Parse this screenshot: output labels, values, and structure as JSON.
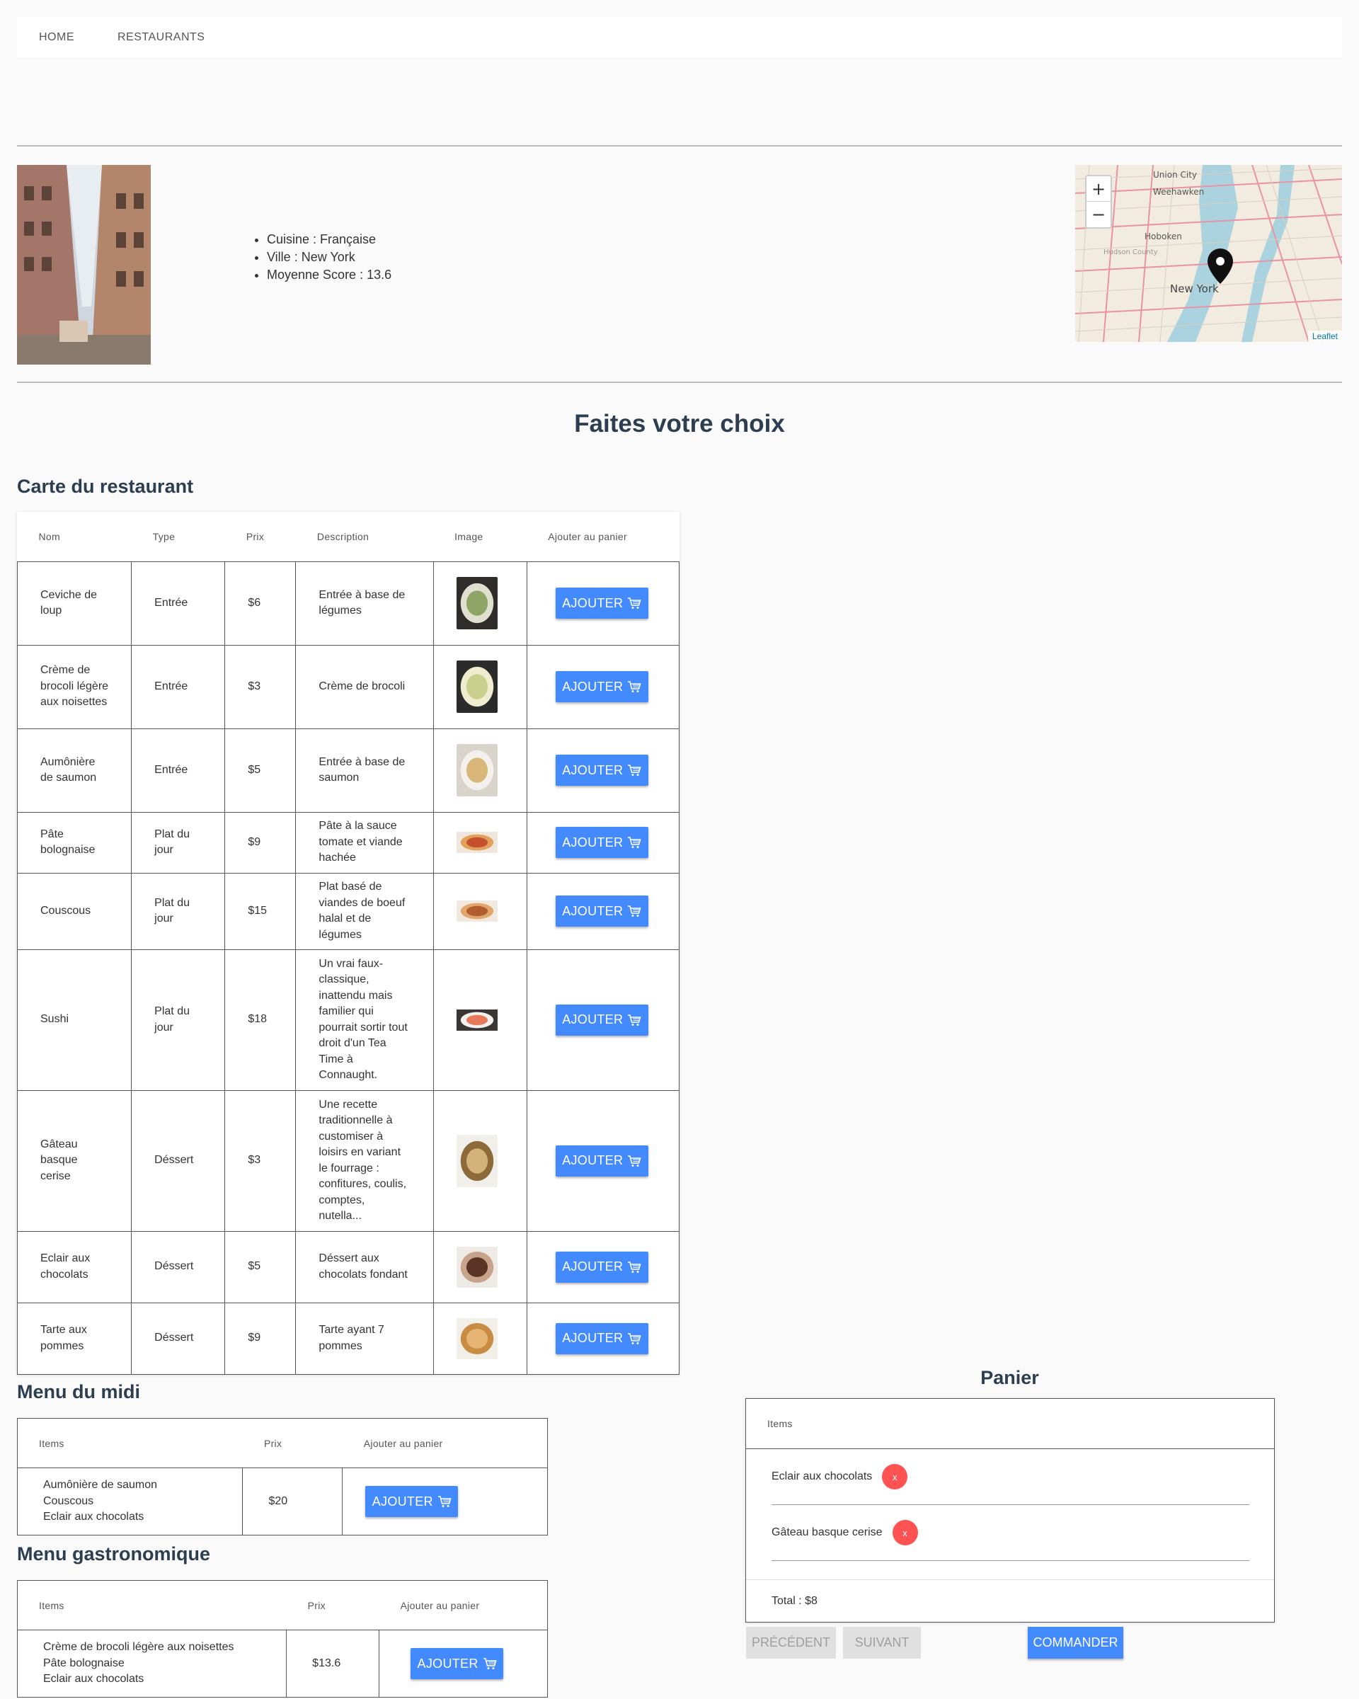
{
  "nav": {
    "items": [
      "HOME",
      "RESTAURANTS"
    ]
  },
  "restaurant": {
    "cuisine": "Cuisine : Française",
    "ville": "Ville : New York",
    "score": "Moyenne Score : 13.6"
  },
  "map": {
    "zoom_in": "+",
    "zoom_out": "−",
    "attribution": "Leaflet",
    "labels": [
      "Union City",
      "Weehawken",
      "Hoboken",
      "Hudson County",
      "New York"
    ]
  },
  "main_title": "Faites votre choix",
  "carte": {
    "title": "Carte du restaurant",
    "headers": [
      "Nom",
      "Type",
      "Prix",
      "Description",
      "Image",
      "Ajouter au panier"
    ],
    "button_label": "AJOUTER",
    "rows": [
      {
        "nom": "Ceviche de loup",
        "type": "Entrée",
        "prix": "$6",
        "description": "Entrée à base de légumes"
      },
      {
        "nom": "Crème de brocoli légère aux noisettes",
        "type": "Entrée",
        "prix": "$3",
        "description": "Crème de brocoli"
      },
      {
        "nom": "Aumônière de saumon",
        "type": "Entrée",
        "prix": "$5",
        "description": "Entrée à base de saumon"
      },
      {
        "nom": "Pâte bolognaise",
        "type": "Plat du jour",
        "prix": "$9",
        "description": "Pâte à la sauce tomate et viande hachée"
      },
      {
        "nom": "Couscous",
        "type": "Plat du jour",
        "prix": "$15",
        "description": "Plat basé de viandes de boeuf halal et de légumes"
      },
      {
        "nom": "Sushi",
        "type": "Plat du jour",
        "prix": "$18",
        "description": "Un vrai faux-classique, inattendu mais familier qui pourrait sortir tout droit d'un Tea Time à Connaught."
      },
      {
        "nom": "Gâteau basque cerise",
        "type": "Déssert",
        "prix": "$3",
        "description": "Une recette traditionnelle à customiser à loisirs en variant le fourrage : confitures, coulis, comptes, nutella..."
      },
      {
        "nom": "Eclair aux chocolats",
        "type": "Déssert",
        "prix": "$5",
        "description": "Déssert aux chocolats fondant"
      },
      {
        "nom": "Tarte aux pommes",
        "type": "Déssert",
        "prix": "$9",
        "description": "Tarte ayant 7 pommes"
      }
    ]
  },
  "midi": {
    "title": "Menu du midi",
    "headers": [
      "Items",
      "Prix",
      "Ajouter au panier"
    ],
    "items": [
      "Aumônière de saumon",
      "Couscous",
      "Eclair aux chocolats"
    ],
    "prix": "$20",
    "button_label": "AJOUTER"
  },
  "gastro": {
    "title": "Menu gastronomique",
    "headers": [
      "Items",
      "Prix",
      "Ajouter au panier"
    ],
    "items": [
      "Crème de brocoli légère aux noisettes",
      "Pâte bolognaise",
      "Eclair aux chocolats"
    ],
    "prix": "$13.6",
    "button_label": "AJOUTER"
  },
  "panier": {
    "title": "Panier",
    "header": "Items",
    "items": [
      "Eclair aux chocolats",
      "Gâteau basque cerise"
    ],
    "remove_label": "x",
    "total": "Total : $8",
    "prev_label": "PRÉCÉDENT",
    "next_label": "SUIVANT",
    "order_label": "COMMANDER"
  },
  "colors": {
    "primary": "#448aff",
    "danger": "#ff5252",
    "title": "#2c3e50"
  }
}
